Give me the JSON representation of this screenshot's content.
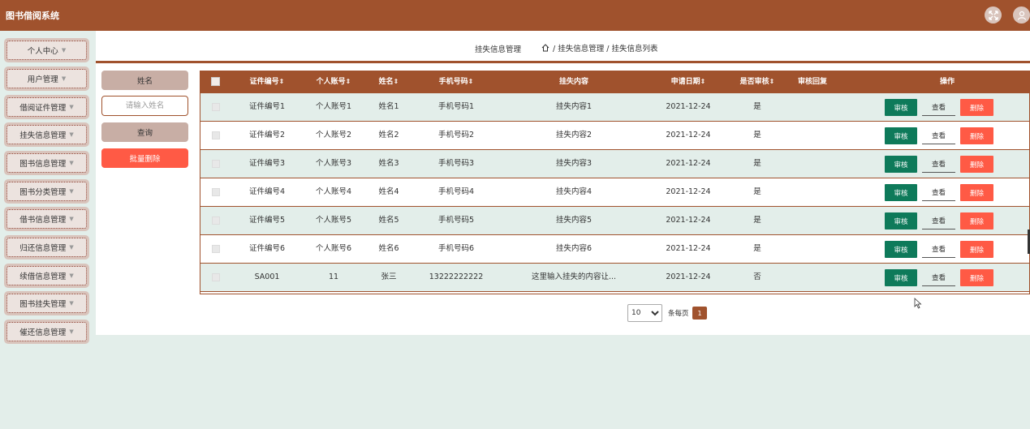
{
  "app": {
    "title": "图书借阅系统"
  },
  "header": {
    "icons": [
      "fullscreen-icon",
      "user-icon"
    ]
  },
  "sidebar": {
    "items": [
      {
        "label": "个人中心"
      },
      {
        "label": "用户管理"
      },
      {
        "label": "借阅证件管理"
      },
      {
        "label": "挂失信息管理"
      },
      {
        "label": "图书信息管理"
      },
      {
        "label": "图书分类管理"
      },
      {
        "label": "借书信息管理"
      },
      {
        "label": "归还信息管理"
      },
      {
        "label": "续借信息管理"
      },
      {
        "label": "图书挂失管理"
      },
      {
        "label": "催还信息管理"
      }
    ]
  },
  "breadcrumb": {
    "title": "挂失信息管理",
    "path": "/ 挂失信息管理 / 挂失信息列表"
  },
  "search": {
    "label": "姓名",
    "placeholder": "请输入姓名",
    "query_button": "查询",
    "batch_delete_button": "批量删除"
  },
  "table": {
    "columns": [
      "证件编号",
      "个人账号",
      "姓名",
      "手机号码",
      "挂失内容",
      "申请日期",
      "是否审核",
      "审核回复",
      "操作"
    ],
    "sortable": [
      "证件编号",
      "个人账号",
      "姓名",
      "手机号码",
      "申请日期",
      "是否审核"
    ],
    "rows": [
      {
        "cert": "证件编号1",
        "account": "个人账号1",
        "name": "姓名1",
        "phone": "手机号码1",
        "content": "挂失内容1",
        "date": "2021-12-24",
        "audited": "是",
        "reply": ""
      },
      {
        "cert": "证件编号2",
        "account": "个人账号2",
        "name": "姓名2",
        "phone": "手机号码2",
        "content": "挂失内容2",
        "date": "2021-12-24",
        "audited": "是",
        "reply": ""
      },
      {
        "cert": "证件编号3",
        "account": "个人账号3",
        "name": "姓名3",
        "phone": "手机号码3",
        "content": "挂失内容3",
        "date": "2021-12-24",
        "audited": "是",
        "reply": ""
      },
      {
        "cert": "证件编号4",
        "account": "个人账号4",
        "name": "姓名4",
        "phone": "手机号码4",
        "content": "挂失内容4",
        "date": "2021-12-24",
        "audited": "是",
        "reply": ""
      },
      {
        "cert": "证件编号5",
        "account": "个人账号5",
        "name": "姓名5",
        "phone": "手机号码5",
        "content": "挂失内容5",
        "date": "2021-12-24",
        "audited": "是",
        "reply": ""
      },
      {
        "cert": "证件编号6",
        "account": "个人账号6",
        "name": "姓名6",
        "phone": "手机号码6",
        "content": "挂失内容6",
        "date": "2021-12-24",
        "audited": "是",
        "reply": ""
      },
      {
        "cert": "SA001",
        "account": "11",
        "name": "张三",
        "phone": "13222222222",
        "content": "这里输入挂失的内容让...",
        "date": "2021-12-24",
        "audited": "否",
        "reply": ""
      }
    ],
    "actions": {
      "audit": "审核",
      "view": "查看",
      "delete": "删除"
    }
  },
  "pagination": {
    "page_size": "10",
    "page_size_options": [
      "10",
      "20",
      "50"
    ],
    "label": "条每页",
    "current_page": "1"
  },
  "colors": {
    "brand": "#a0522d",
    "row_alt": "#e3eeea",
    "audit_button": "#0e7a5a",
    "delete_button": "#ff5a45"
  }
}
